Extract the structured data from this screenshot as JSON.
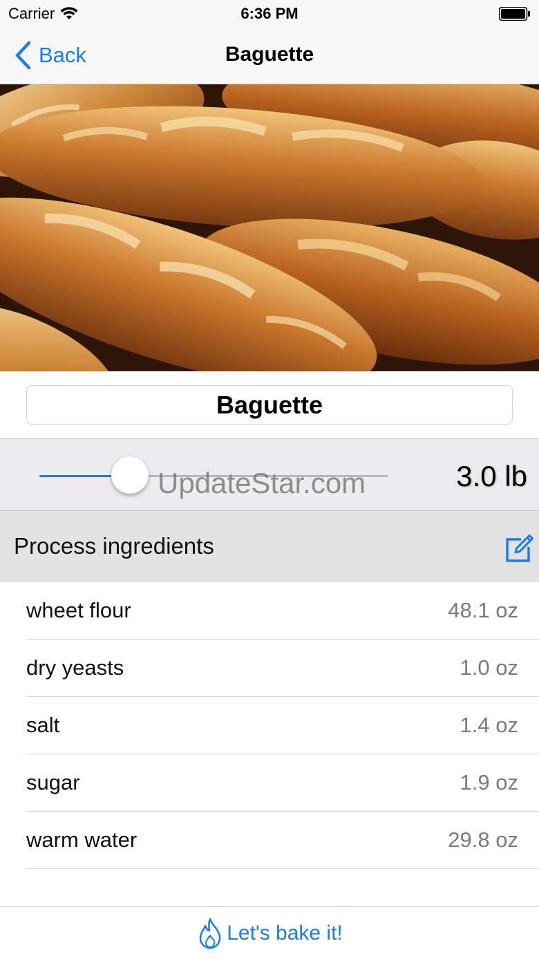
{
  "status_bar": {
    "carrier": "Carrier",
    "time": "6:36 PM",
    "icons": [
      "wifi-icon",
      "battery-icon"
    ]
  },
  "nav": {
    "back_label": "Back",
    "title": "Baguette",
    "back_icon": "chevron-left-icon"
  },
  "hero": {
    "description_icon": "baguette-photo"
  },
  "recipe": {
    "name": "Baguette"
  },
  "weight": {
    "slider_fraction": 0.26,
    "value_label": "3.0 lb",
    "watermark": "UpdateStar.com"
  },
  "section": {
    "title": "Process ingredients",
    "edit_icon": "edit-icon"
  },
  "ingredients": [
    {
      "name": "wheet flour",
      "amount": "48.1 oz"
    },
    {
      "name": "dry yeasts",
      "amount": "1.0 oz"
    },
    {
      "name": "salt",
      "amount": "1.4 oz"
    },
    {
      "name": "sugar",
      "amount": "1.9 oz"
    },
    {
      "name": "warm water",
      "amount": "29.8 oz"
    }
  ],
  "bottom": {
    "bake_label": "Let's bake it!",
    "bake_icon": "flame-icon"
  },
  "colors": {
    "accent": "#1b7cf2",
    "bar_background": "#f7f7f7",
    "section_background": "#e2e2e2",
    "slider_background": "#ebebf0",
    "secondary_text": "#7a7a7a"
  }
}
